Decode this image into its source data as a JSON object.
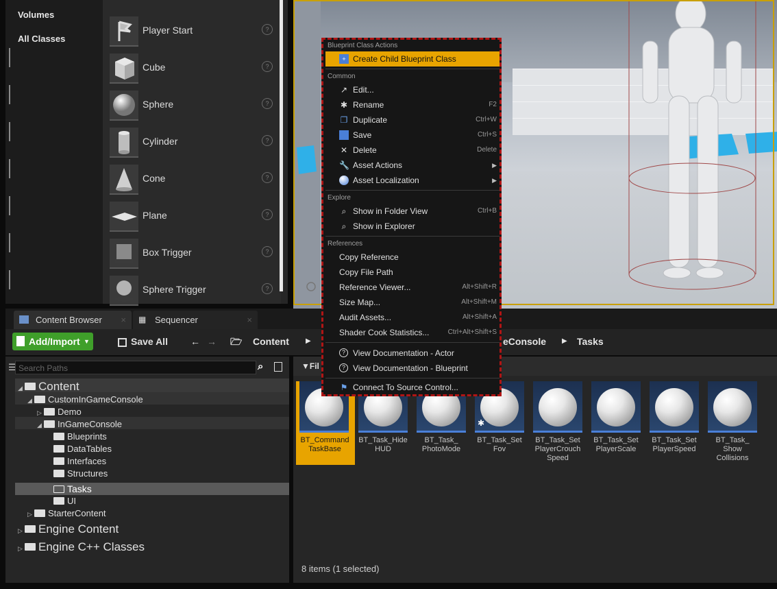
{
  "placement": {
    "categories": [
      "Volumes",
      "All Classes"
    ],
    "items": [
      {
        "label": "Player Start",
        "icon": "player-start-icon"
      },
      {
        "label": "Cube",
        "icon": "cube-icon"
      },
      {
        "label": "Sphere",
        "icon": "sphere-icon"
      },
      {
        "label": "Cylinder",
        "icon": "cylinder-icon"
      },
      {
        "label": "Cone",
        "icon": "cone-icon"
      },
      {
        "label": "Plane",
        "icon": "plane-icon"
      },
      {
        "label": "Box Trigger",
        "icon": "box-trigger-icon"
      },
      {
        "label": "Sphere Trigger",
        "icon": "sphere-trigger-icon"
      }
    ]
  },
  "tabs": {
    "content_browser": "Content Browser",
    "sequencer": "Sequencer"
  },
  "toolbar": {
    "add_import": "Add/Import",
    "save_all": "Save All",
    "breadcrumb_root": "Content",
    "breadcrumb_partial": "eConsole",
    "breadcrumb_last": "Tasks"
  },
  "sources": {
    "search_placeholder": "Search Paths",
    "tree": [
      {
        "label": "Content",
        "depth": 0
      },
      {
        "label": "CustomInGameConsole",
        "depth": 1
      },
      {
        "label": "Demo",
        "depth": 2
      },
      {
        "label": "InGameConsole",
        "depth": 2
      },
      {
        "label": "Blueprints",
        "depth": 3
      },
      {
        "label": "DataTables",
        "depth": 3
      },
      {
        "label": "Interfaces",
        "depth": 3
      },
      {
        "label": "Structures",
        "depth": 3
      },
      {
        "label": "Tasks",
        "depth": 3
      },
      {
        "label": "UI",
        "depth": 3
      },
      {
        "label": "StarterContent",
        "depth": 1
      },
      {
        "label": "Engine Content",
        "depth": 0
      },
      {
        "label": "Engine C++ Classes",
        "depth": 0
      }
    ]
  },
  "assets": {
    "filter_label": "Fil",
    "items": [
      {
        "line1": "BT_Command",
        "line2": "TaskBase",
        "line3": ""
      },
      {
        "line1": "BT_Task_Hide",
        "line2": "HUD",
        "line3": ""
      },
      {
        "line1": "BT_Task_",
        "line2": "PhotoMode",
        "line3": ""
      },
      {
        "line1": "BT_Task_Set",
        "line2": "Fov",
        "line3": ""
      },
      {
        "line1": "BT_Task_Set",
        "line2": "PlayerCrouch",
        "line3": "Speed"
      },
      {
        "line1": "BT_Task_Set",
        "line2": "PlayerScale",
        "line3": ""
      },
      {
        "line1": "BT_Task_Set",
        "line2": "PlayerSpeed",
        "line3": ""
      },
      {
        "line1": "BT_Task_",
        "line2": "Show",
        "line3": "Collisions"
      }
    ],
    "status": "8 items (1 selected)"
  },
  "context_menu": {
    "sections": {
      "blueprint": "Blueprint Class Actions",
      "common": "Common",
      "explore": "Explore",
      "references": "References"
    },
    "create_child": "Create Child Blueprint Class",
    "common": [
      {
        "label": "Edit...",
        "shortcut": ""
      },
      {
        "label": "Rename",
        "shortcut": "F2"
      },
      {
        "label": "Duplicate",
        "shortcut": "Ctrl+W"
      },
      {
        "label": "Save",
        "shortcut": "Ctrl+S"
      },
      {
        "label": "Delete",
        "shortcut": "Delete"
      },
      {
        "label": "Asset Actions",
        "shortcut": ""
      },
      {
        "label": "Asset Localization",
        "shortcut": ""
      }
    ],
    "explore": [
      {
        "label": "Show in Folder View",
        "shortcut": "Ctrl+B"
      },
      {
        "label": "Show in Explorer",
        "shortcut": ""
      }
    ],
    "references": [
      {
        "label": "Copy Reference",
        "shortcut": ""
      },
      {
        "label": "Copy File Path",
        "shortcut": ""
      },
      {
        "label": "Reference Viewer...",
        "shortcut": "Alt+Shift+R"
      },
      {
        "label": "Size Map...",
        "shortcut": "Alt+Shift+M"
      },
      {
        "label": "Audit Assets...",
        "shortcut": "Alt+Shift+A"
      },
      {
        "label": "Shader Cook Statistics...",
        "shortcut": "Ctrl+Alt+Shift+S"
      }
    ],
    "docs": [
      {
        "label": "View Documentation - Actor"
      },
      {
        "label": "View Documentation - Blueprint"
      }
    ],
    "source_control": "Connect To Source Control..."
  },
  "colors": {
    "accent": "#e8a400",
    "add_button": "#3f9f2a",
    "menu_border": "#b01515"
  }
}
